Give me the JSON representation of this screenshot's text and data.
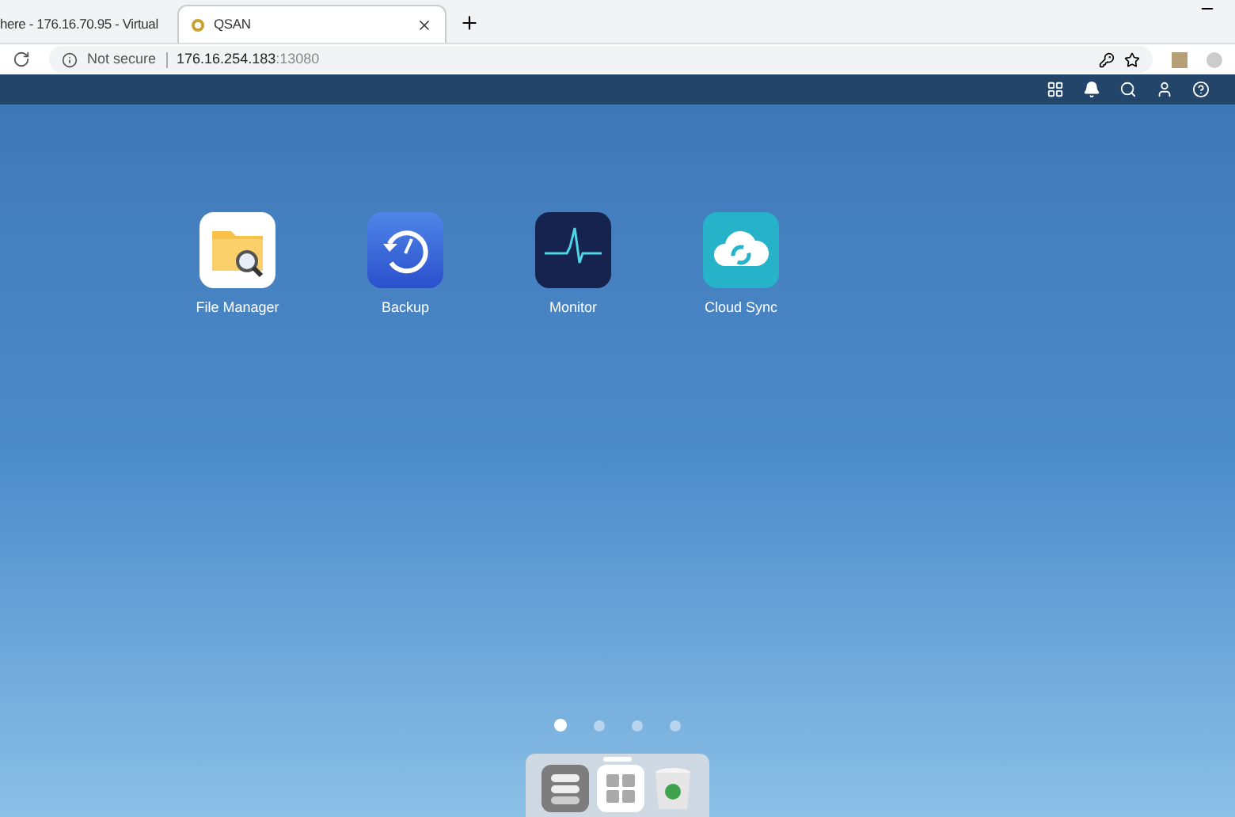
{
  "browser": {
    "tabs": [
      {
        "title": "here - 176.16.70.95 - Virtual",
        "selected": false
      },
      {
        "title": "QSAN",
        "selected": true
      }
    ],
    "address": {
      "security": "Not secure",
      "host": "176.16.254.183",
      "port": ":13080"
    }
  },
  "apps": [
    {
      "kind": "files",
      "label": "File Manager"
    },
    {
      "kind": "backup",
      "label": "Backup"
    },
    {
      "kind": "monitor",
      "label": "Monitor"
    },
    {
      "kind": "cloud",
      "label": "Cloud Sync"
    }
  ],
  "pages": [
    {
      "selected": true
    },
    {
      "selected": false
    },
    {
      "selected": false
    },
    {
      "selected": false
    }
  ],
  "dock": [
    {
      "kind": "storage"
    },
    {
      "kind": "apps"
    },
    {
      "kind": "trash"
    }
  ]
}
